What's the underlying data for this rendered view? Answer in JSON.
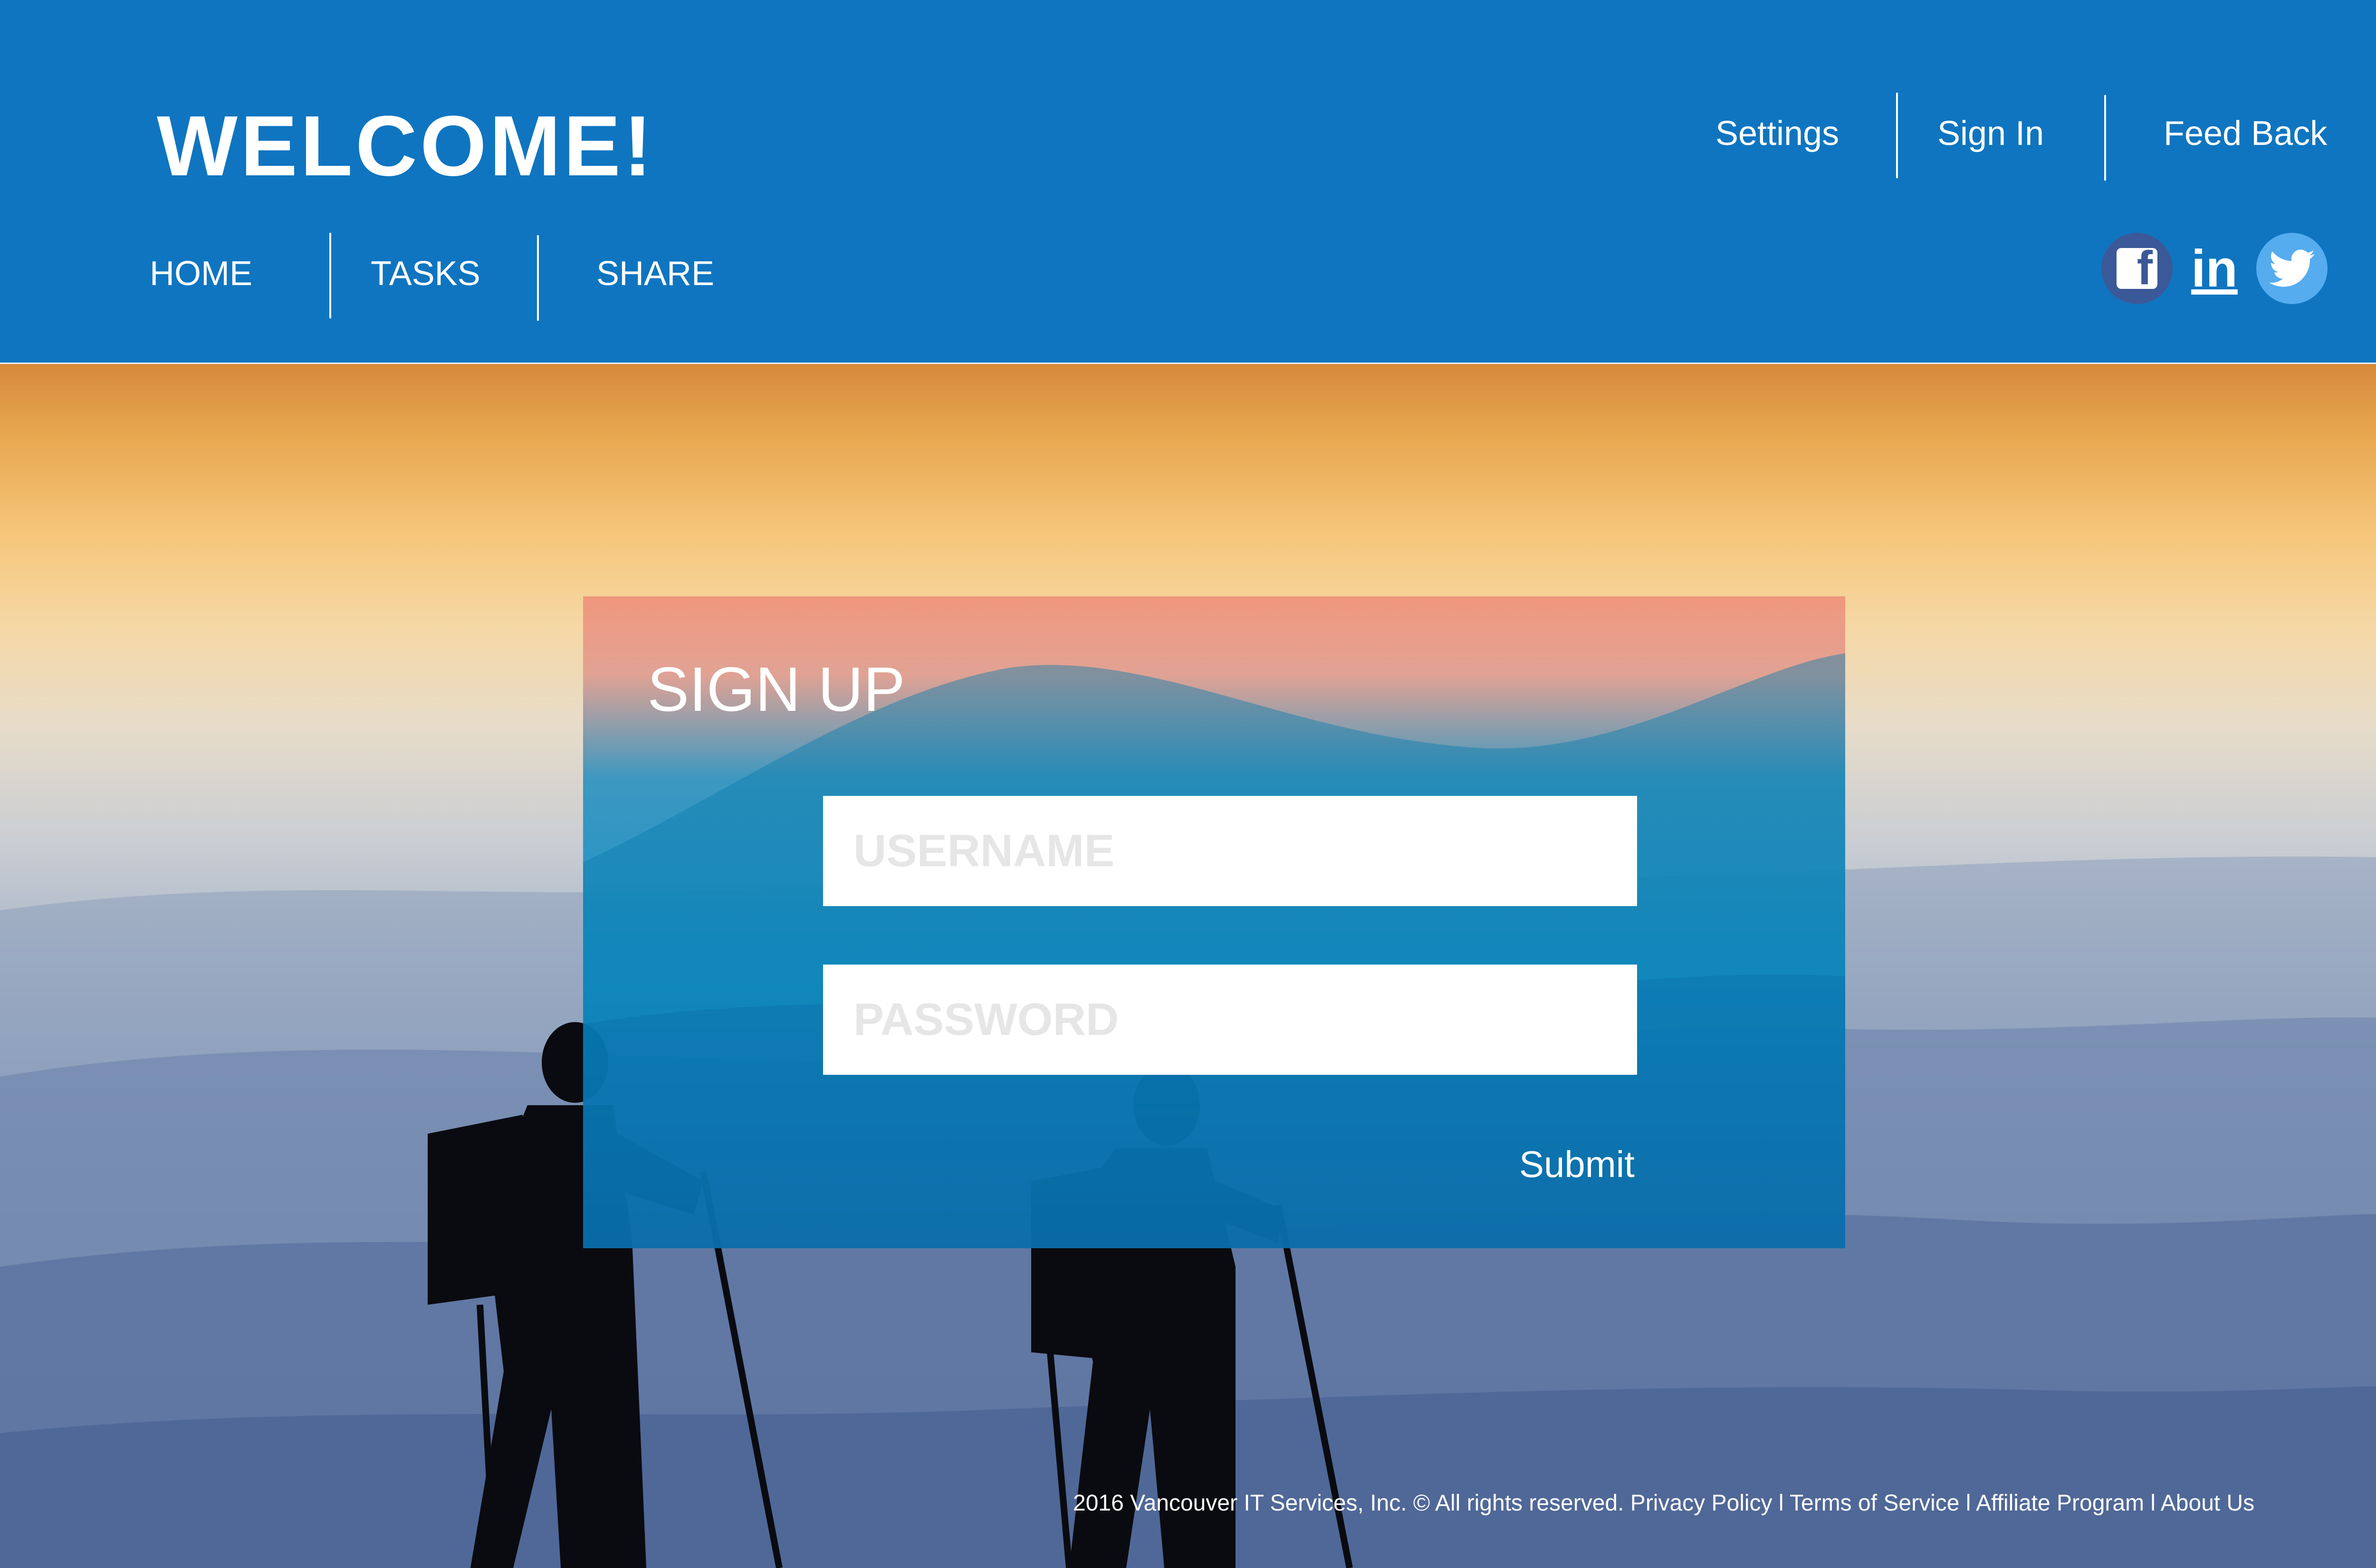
{
  "header": {
    "title": "WELCOME!",
    "top_nav": [
      {
        "label": "Settings"
      },
      {
        "label": "Sign In"
      },
      {
        "label": "Feed Back"
      }
    ],
    "main_nav": [
      {
        "label": "HOME"
      },
      {
        "label": "TASKS"
      },
      {
        "label": "SHARE"
      }
    ],
    "social": [
      "facebook-icon",
      "linkedin-icon",
      "twitter-icon"
    ],
    "linkedin_text": "in",
    "background_color": "#0f75c0"
  },
  "signup": {
    "title": "SIGN UP",
    "username_placeholder": "USERNAME",
    "password_placeholder": "PASSWORD",
    "submit_label": "Submit"
  },
  "footer": {
    "copyright": "2016 Vancouver IT Services, Inc. © All rights reserved.",
    "links": [
      "Privacy Policy",
      "Terms of Service",
      "Affiliate Program",
      "About Us"
    ],
    "separator": "l"
  }
}
